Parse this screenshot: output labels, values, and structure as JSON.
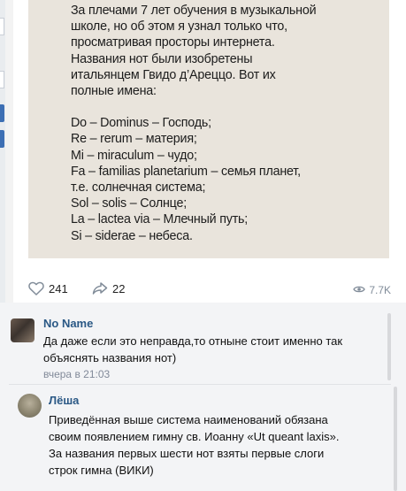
{
  "post": {
    "image_text": {
      "intro": [
        "За плечами 7 лет обучения в музыкальной",
        "школе, но об этом я узнал только что,",
        "просматривая просторы интернета.",
        "Названия нот были изобретены",
        "итальянцем Гвидо д’Ареццо. Вот их",
        "полные имена:"
      ],
      "notes": [
        "Do – Dominus – Господь;",
        "Re – rerum – материя;",
        "Mi – miraculum – чудо;",
        "Fa – familias planetarium – семья планет,",
        "т.е. солнечная система;",
        "Sol – solis – Солнце;",
        "La – lactea via – Млечный путь;",
        "Si – siderae – небеса."
      ]
    },
    "likes": "241",
    "shares": "22",
    "views": "7.7K"
  },
  "comments": [
    {
      "author": "No Name",
      "text_lines": [
        "Да даже если это неправда,то отныне стоит именно так",
        "объяснять названия нот)"
      ],
      "time": "вчера в 21:03"
    },
    {
      "author": "Лёша",
      "text_lines": [
        "Приведённая выше система наименований обязана",
        "своим появлением гимну св. Иоанну «Ut queant laxis».",
        "За названия первых шести нот взяты первые слоги",
        "строк гимна  (ВИКИ)"
      ]
    }
  ],
  "colors": {
    "link": "#2a5885",
    "muted": "#818c99",
    "accent": "#3d6fb4"
  },
  "icons": [
    "heart-icon",
    "share-icon",
    "eye-icon"
  ]
}
